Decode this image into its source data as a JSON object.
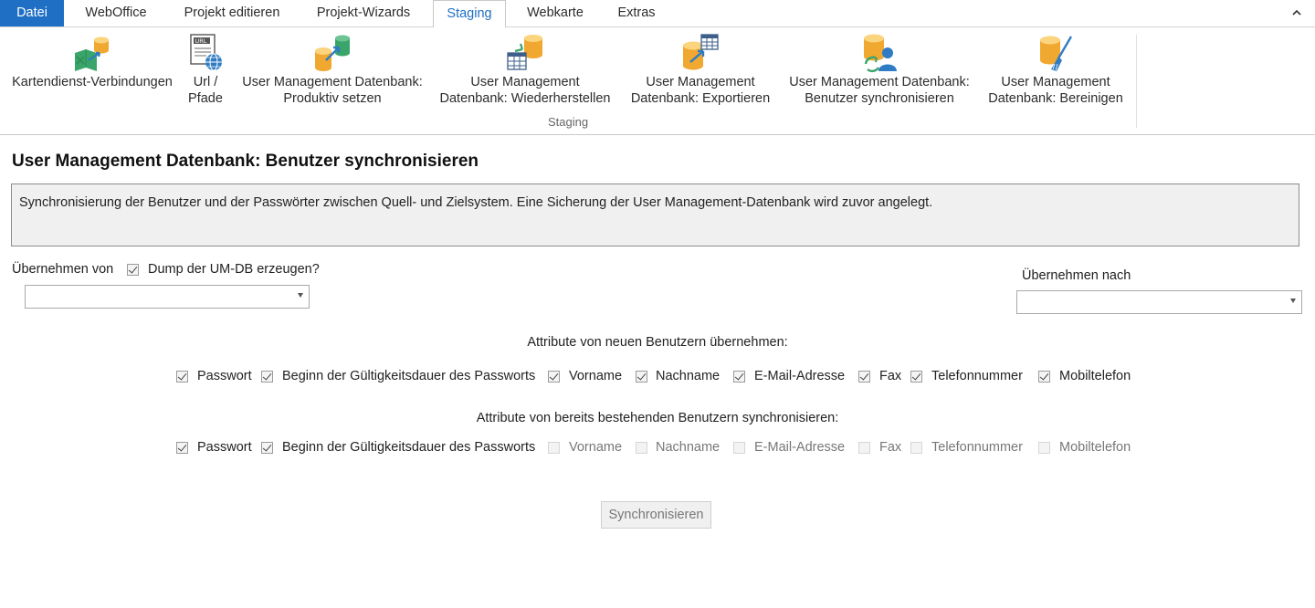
{
  "tabs": {
    "file": "Datei",
    "webofficeLabel": "WebOffice",
    "projectEdit": "Projekt editieren",
    "projectWizards": "Projekt-Wizards",
    "staging": "Staging",
    "webmap": "Webkarte",
    "extras": "Extras"
  },
  "ribbon": {
    "buttons": [
      {
        "line1": "Kartendienst-Verbindungen",
        "line2": ""
      },
      {
        "line1": "Url /",
        "line2": "Pfade"
      },
      {
        "line1": "User Management Datenbank:",
        "line2": "Produktiv setzen"
      },
      {
        "line1": "User Management",
        "line2": "Datenbank: Wiederherstellen"
      },
      {
        "line1": "User Management",
        "line2": "Datenbank: Exportieren"
      },
      {
        "line1": "User Management Datenbank:",
        "line2": "Benutzer synchronisieren"
      },
      {
        "line1": "User Management",
        "line2": "Datenbank: Bereinigen"
      }
    ],
    "group_label": "Staging"
  },
  "page": {
    "title": "User Management Datenbank: Benutzer synchronisieren",
    "description": "Synchronisierung der Benutzer und der Passwörter zwischen Quell- und Zielsystem. Eine Sicherung der User Management-Datenbank wird zuvor angelegt.",
    "from_label": "Übernehmen von",
    "dump_label": "Dump der UM-DB erzeugen?",
    "dump_checked": true,
    "from_value": "",
    "to_label": "Übernehmen nach",
    "to_value": ""
  },
  "new_users": {
    "heading": "Attribute von neuen Benutzern übernehmen:",
    "attrs": [
      {
        "label": "Passwort",
        "checked": true
      },
      {
        "label": "Beginn der Gültigkeitsdauer des Passworts",
        "checked": true
      },
      {
        "label": "Vorname",
        "checked": true
      },
      {
        "label": "Nachname",
        "checked": true
      },
      {
        "label": "E-Mail-Adresse",
        "checked": true
      },
      {
        "label": "Fax",
        "checked": true
      },
      {
        "label": "Telefonnummer",
        "checked": true
      },
      {
        "label": "Mobiltelefon",
        "checked": true
      }
    ]
  },
  "existing_users": {
    "heading": "Attribute von bereits bestehenden Benutzern synchronisieren:",
    "attrs": [
      {
        "label": "Passwort",
        "checked": true
      },
      {
        "label": "Beginn der Gültigkeitsdauer des Passworts",
        "checked": true
      },
      {
        "label": "Vorname",
        "checked": false
      },
      {
        "label": "Nachname",
        "checked": false
      },
      {
        "label": "E-Mail-Adresse",
        "checked": false
      },
      {
        "label": "Fax",
        "checked": false
      },
      {
        "label": "Telefonnummer",
        "checked": false
      },
      {
        "label": "Mobiltelefon",
        "checked": false
      }
    ]
  },
  "actions": {
    "sync": "Synchronisieren"
  },
  "icons": {
    "b0": "map-service-connections-icon",
    "b1": "url-paths-icon",
    "b2": "db-set-productive-icon",
    "b3": "db-restore-icon",
    "b4": "db-export-icon",
    "b5": "db-sync-users-icon",
    "b6": "db-cleanup-icon",
    "collapse": "chevron-up-icon"
  },
  "colors": {
    "accent": "#1f6fc5",
    "db": "#f0a830",
    "green": "#3aa56a",
    "blue": "#2f7cc4"
  }
}
